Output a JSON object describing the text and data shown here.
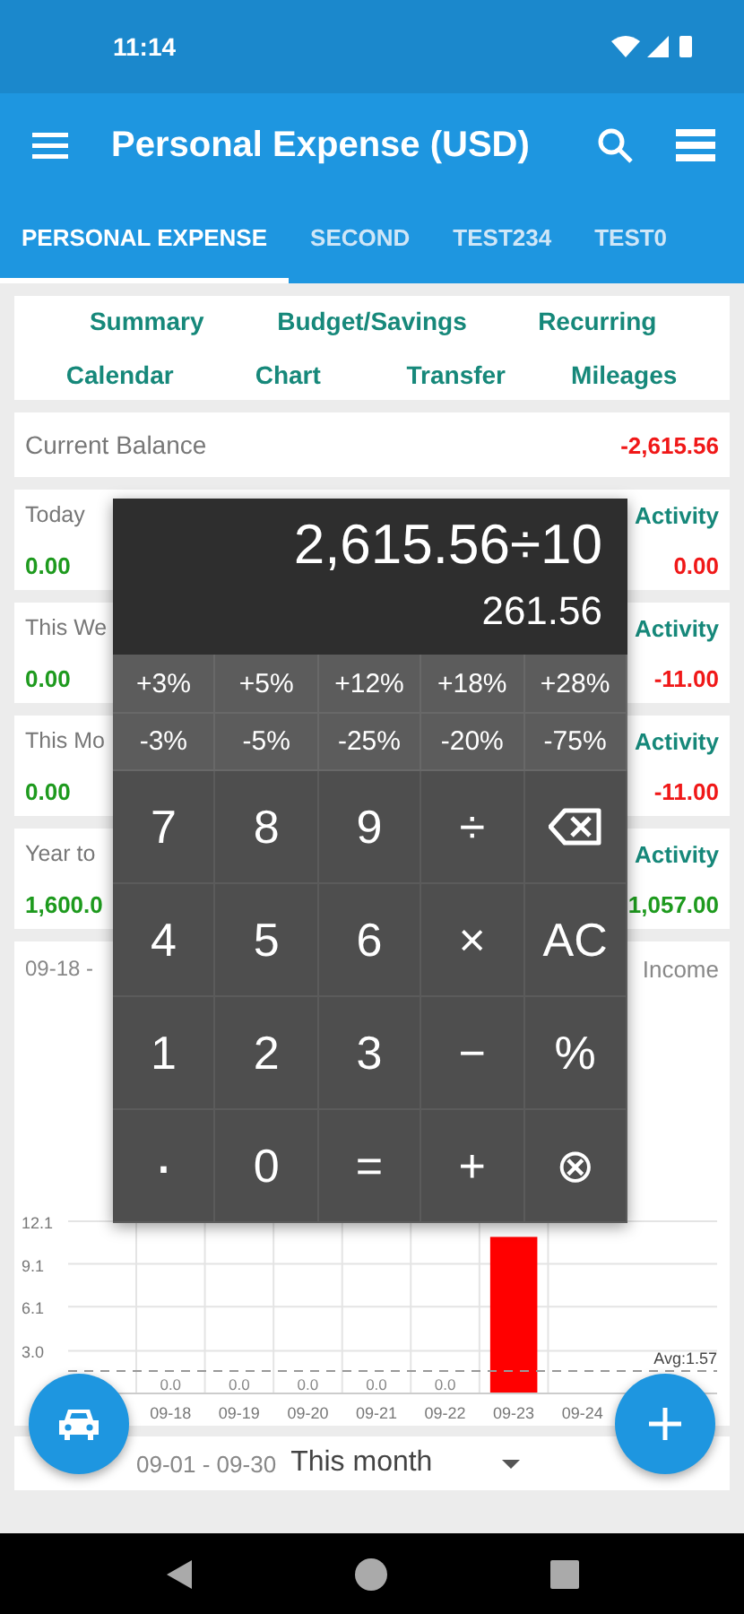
{
  "status_bar": {
    "time": "11:14"
  },
  "app_bar": {
    "title": "Personal Expense (USD)"
  },
  "tabs": [
    {
      "label": "PERSONAL EXPENSE",
      "selected": true
    },
    {
      "label": "SECOND",
      "selected": false
    },
    {
      "label": "TEST234",
      "selected": false
    },
    {
      "label": "TEST0",
      "selected": false
    }
  ],
  "shortcuts": [
    {
      "label": "Summary"
    },
    {
      "label": "Budget/Savings"
    },
    {
      "label": "Recurring"
    },
    {
      "label": "Calendar"
    },
    {
      "label": "Chart"
    },
    {
      "label": "Transfer"
    },
    {
      "label": "Mileages"
    }
  ],
  "balance": {
    "label": "Current Balance",
    "value": "-2,615.56"
  },
  "periods": [
    {
      "label": "Today",
      "income": "0.00",
      "link": "Activity",
      "net": {
        "text": "0.00",
        "color": "#f01818"
      }
    },
    {
      "label": "This We",
      "income": "0.00",
      "link": "Activity",
      "net": {
        "text": "-11.00",
        "color": "#f01818"
      }
    },
    {
      "label": "This Mo",
      "income": "0.00",
      "link": "Activity",
      "net": {
        "text": "-11.00",
        "color": "#f01818"
      }
    },
    {
      "label": "Year to",
      "income": "1,600.0",
      "link": "Activity",
      "net": {
        "text": "1,057.00",
        "color": "#1e9a1e"
      }
    }
  ],
  "chart": {
    "range": "09-18 -",
    "option_label": "Income",
    "chart_data": {
      "type": "bar",
      "categories": [
        "09-18",
        "09-19",
        "09-20",
        "09-21",
        "09-22",
        "09-23",
        "09-24"
      ],
      "series": [
        {
          "color": "#ff0000",
          "values": [
            0,
            0,
            0,
            0,
            0,
            11,
            0
          ]
        }
      ],
      "ylim": [
        0,
        12.1
      ],
      "grid": true,
      "yticks": [
        {
          "value": 3,
          "label": "3.0"
        },
        {
          "value": 6.1,
          "label": "6.1"
        },
        {
          "value": 9.1,
          "label": "9.1"
        },
        {
          "value": 12.1,
          "label": "12.1"
        }
      ],
      "value_labels": [
        "0.0",
        "0.0",
        "0.0",
        "0.0",
        "0.0",
        null,
        null
      ],
      "ref_lines": [
        {
          "axis": "y",
          "value": 1.57,
          "label": "Avg:1.57"
        }
      ]
    }
  },
  "footer": {
    "range": "09-01 - 09-30",
    "period": "This month"
  },
  "calculator": {
    "expression": "2,615.56÷10",
    "result": "261.56",
    "keys": [
      {
        "kind": "percent",
        "label": "+3%"
      },
      {
        "kind": "percent",
        "label": "+5%"
      },
      {
        "kind": "percent",
        "label": "+12%"
      },
      {
        "kind": "percent",
        "label": "+18%"
      },
      {
        "kind": "percent",
        "label": "+28%"
      },
      {
        "kind": "percent",
        "label": "-3%"
      },
      {
        "kind": "percent",
        "label": "-5%"
      },
      {
        "kind": "percent",
        "label": "-25%"
      },
      {
        "kind": "percent",
        "label": "-20%"
      },
      {
        "kind": "percent",
        "label": "-75%"
      },
      {
        "kind": "key",
        "label": "7"
      },
      {
        "kind": "key",
        "label": "8"
      },
      {
        "kind": "key",
        "label": "9"
      },
      {
        "kind": "key",
        "label": "÷"
      },
      {
        "kind": "backspace"
      },
      {
        "kind": "key",
        "label": "4"
      },
      {
        "kind": "key",
        "label": "5"
      },
      {
        "kind": "key",
        "label": "6"
      },
      {
        "kind": "key",
        "label": "×"
      },
      {
        "kind": "key",
        "label": "AC"
      },
      {
        "kind": "key",
        "label": "1"
      },
      {
        "kind": "key",
        "label": "2"
      },
      {
        "kind": "key",
        "label": "3"
      },
      {
        "kind": "key",
        "label": "−"
      },
      {
        "kind": "key",
        "label": "%"
      },
      {
        "kind": "point",
        "label": "."
      },
      {
        "kind": "key",
        "label": "0"
      },
      {
        "kind": "key",
        "label": "="
      },
      {
        "kind": "key",
        "label": "+"
      },
      {
        "kind": "key",
        "label": "⊗"
      }
    ]
  }
}
